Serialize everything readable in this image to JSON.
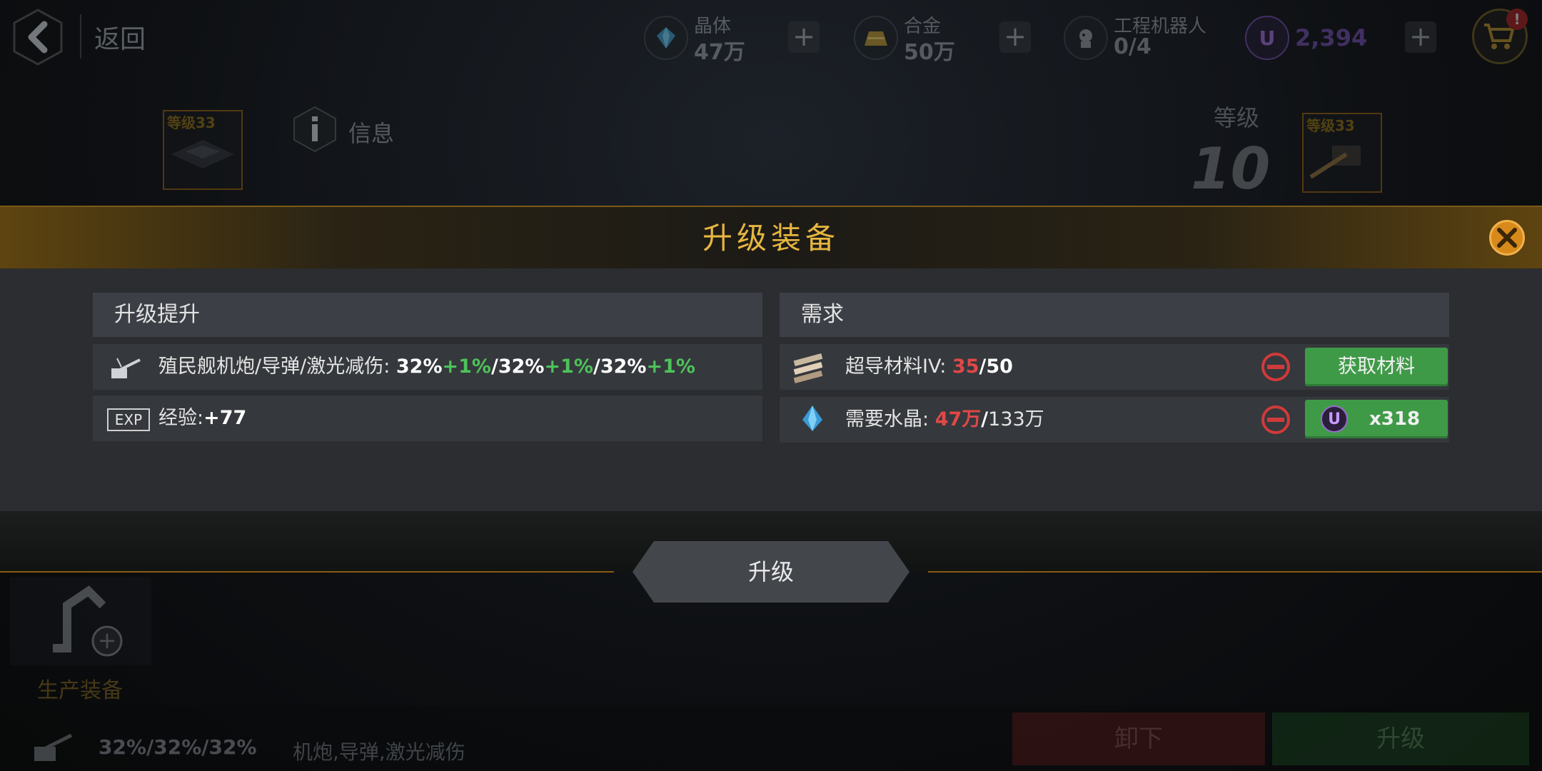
{
  "topbar": {
    "back_label": "返回",
    "resources": [
      {
        "name": "晶体",
        "value": "47万",
        "icon": "crystal-icon",
        "color": "#4aa3c8"
      },
      {
        "name": "合金",
        "value": "50万",
        "icon": "alloy-icon",
        "color": "#c8a040"
      },
      {
        "name": "工程机器人",
        "value": "0/4",
        "icon": "robot-icon",
        "color": "#9aa0a6"
      }
    ],
    "premium": {
      "symbol": "U",
      "value": "2,394",
      "color": "#7a4cc0"
    },
    "cart_badge": "!"
  },
  "equipment": {
    "left_thumb_level": "等级33",
    "right_thumb_level": "等级33",
    "info_label": "信息",
    "level_title": "等级",
    "level_value": "10"
  },
  "modal": {
    "title": "升级装备",
    "left_panel": {
      "header": "升级提升",
      "stat_row": {
        "label": "殖民舰机炮/导弹/激光减伤: ",
        "v1": "32%",
        "b1": "+1%",
        "v2": "32%",
        "b2": "+1%",
        "v3": "32%",
        "b3": "+1%"
      },
      "exp_row": {
        "badge": "EXP",
        "label": "经验:",
        "value": "+77"
      }
    },
    "right_panel": {
      "header": "需求",
      "material_row": {
        "label": "超导材料IV: ",
        "have": "35",
        "need": "50",
        "button": "获取材料"
      },
      "crystal_row": {
        "label": "需要水晶: ",
        "have": "47万",
        "need": "133万",
        "coin": "U",
        "cost": "x318"
      }
    },
    "upgrade_button": "升级"
  },
  "bottom": {
    "produce_label": "生产装备",
    "stat_values": "32%/32%/32%",
    "stat_desc": "机炮,导弹,激光减伤",
    "unload_button": "卸下",
    "upgrade_button": "升级"
  }
}
